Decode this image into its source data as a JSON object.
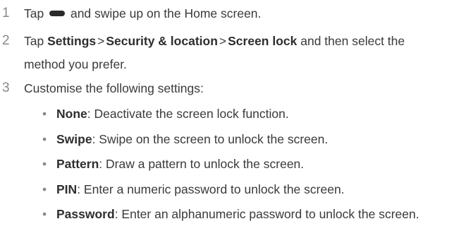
{
  "steps": [
    {
      "number": "1",
      "text_before": "Tap",
      "icon": "home-bar-icon",
      "text_after": "and swipe up on the Home screen."
    },
    {
      "number": "2",
      "text_before": "Tap",
      "path": [
        "Settings",
        "Security & location",
        "Screen lock"
      ],
      "separator": ">",
      "text_after": "and then select the",
      "line2": "method you prefer."
    },
    {
      "number": "3",
      "text": "Customise the following settings:"
    }
  ],
  "options": [
    {
      "name": "None",
      "desc": ": Deactivate the screen lock function."
    },
    {
      "name": "Swipe",
      "desc": ": Swipe on the screen to unlock the screen."
    },
    {
      "name": "Pattern",
      "desc": ": Draw a pattern to unlock the screen."
    },
    {
      "name": "PIN",
      "desc": ": Enter a numeric password to unlock the screen."
    },
    {
      "name": "Password",
      "desc": ": Enter an alphanumeric password to unlock the screen."
    }
  ],
  "bullet_char": "•"
}
